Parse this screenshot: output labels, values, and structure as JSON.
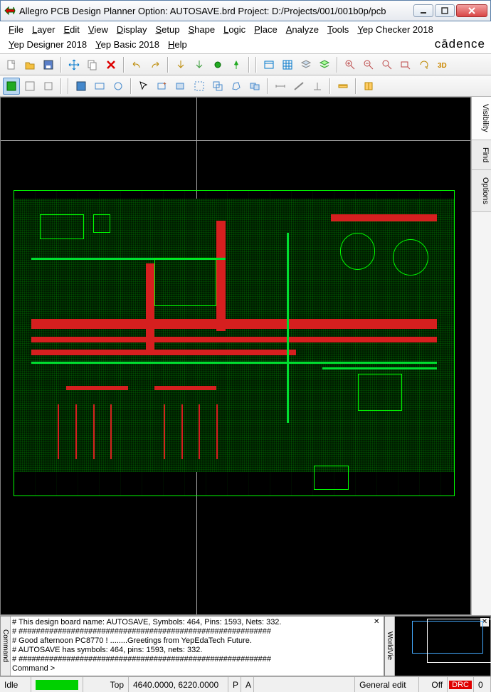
{
  "title": "Allegro PCB Design Planner Option: AUTOSAVE.brd  Project: D:/Projects/001/001b0p/pcb",
  "menu": {
    "row1": [
      "File",
      "Layer",
      "Edit",
      "View",
      "Display",
      "Setup",
      "Shape",
      "Logic",
      "Place",
      "Analyze",
      "Tools",
      "Yep Checker 2018"
    ],
    "row2": [
      "Yep Designer 2018",
      "Yep Basic 2018",
      "Help"
    ]
  },
  "brand": "cādence",
  "side_tabs": [
    "Visibility",
    "Find",
    "Options"
  ],
  "console": {
    "tab": "Command",
    "lines": [
      "This design board name: AUTOSAVE, Symbols: 464, Pins: 1593, Nets: 332.",
      "##########################################################",
      "Good afternoon PC8770 !       ........Greetings from YepEdaTech Future.",
      "AUTOSAVE has symbols: 464, pins: 1593, nets: 332.",
      "##########################################################"
    ],
    "prompt": "Command >"
  },
  "worldview_tab": "WorldVie",
  "status": {
    "idle": "Idle",
    "top": "Top",
    "coords": "4640.0000, 6220.0000",
    "p": "P",
    "a": "A",
    "mode": "General edit",
    "off": "Off",
    "drc": "DRC",
    "drc_count": "0"
  },
  "toolbar1": [
    "new-icon",
    "open-icon",
    "save-icon",
    "sep",
    "move-icon",
    "copy-icon",
    "delete-icon",
    "sep",
    "undo-icon",
    "redo-icon",
    "sep",
    "down-arrow-icon",
    "down-arrow2-icon",
    "push-icon",
    "pin-icon",
    "sep",
    "sep",
    "window-icon",
    "grid-icon",
    "layer-icon",
    "layer2-icon",
    "sep",
    "zoom-in-icon",
    "zoom-out-icon",
    "zoom-fit-icon",
    "zoom-window-icon",
    "refresh-icon",
    "3d-icon"
  ],
  "toolbar2": [
    "layer-square-icon",
    "outline-sq-icon",
    "outline-sq2-icon",
    "sep",
    "sep",
    "fill-sq-icon",
    "rect-icon",
    "circle-icon",
    "sep",
    "select-icon",
    "add-rect-icon",
    "add-rect2-icon",
    "outline-icon",
    "copy-rect-icon",
    "polygon-icon",
    "merge-icon",
    "sep",
    "dim-icon",
    "line-icon",
    "perp-icon",
    "sep",
    "ruler-icon",
    "sep",
    "book-icon"
  ]
}
